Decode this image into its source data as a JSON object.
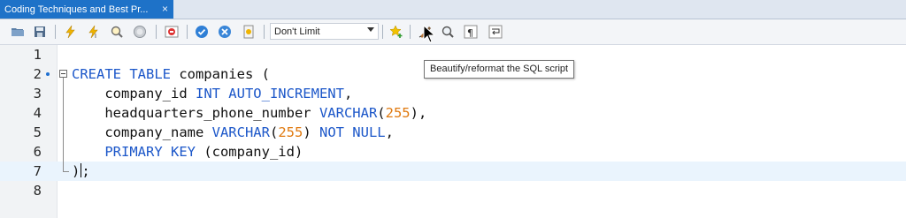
{
  "tab": {
    "title": "Coding Techniques and Best Pr...",
    "close": "×"
  },
  "toolbar": {
    "buttons": [
      {
        "name": "open-folder-icon"
      },
      {
        "name": "save-icon"
      },
      {
        "name": "execute-lightning-icon"
      },
      {
        "name": "execute-current-icon"
      },
      {
        "name": "explain-magnifier-icon"
      },
      {
        "name": "stop-icon"
      },
      {
        "name": "toggle-error-icon"
      },
      {
        "name": "commit-check-icon"
      },
      {
        "name": "rollback-cancel-icon"
      },
      {
        "name": "autocommit-icon"
      },
      {
        "name": "add-snippet-star-icon"
      },
      {
        "name": "beautify-brush-icon"
      },
      {
        "name": "find-icon"
      },
      {
        "name": "invisible-chars-icon"
      },
      {
        "name": "wrap-lines-icon"
      }
    ],
    "limit_value": "Don't Limit"
  },
  "editor": {
    "line_numbers": [
      "1",
      "2",
      "3",
      "4",
      "5",
      "6",
      "7",
      "8"
    ],
    "lines": [
      [],
      [
        {
          "t": "CREATE TABLE",
          "c": "kw"
        },
        {
          "t": " companies (",
          "c": ""
        }
      ],
      [
        {
          "t": "    company_id ",
          "c": ""
        },
        {
          "t": "INT AUTO_INCREMENT",
          "c": "kw"
        },
        {
          "t": ",",
          "c": ""
        }
      ],
      [
        {
          "t": "    headquarters_phone_number ",
          "c": ""
        },
        {
          "t": "VARCHAR",
          "c": "kw"
        },
        {
          "t": "(",
          "c": ""
        },
        {
          "t": "255",
          "c": "num"
        },
        {
          "t": "),",
          "c": ""
        }
      ],
      [
        {
          "t": "    company_name ",
          "c": ""
        },
        {
          "t": "VARCHAR",
          "c": "kw"
        },
        {
          "t": "(",
          "c": ""
        },
        {
          "t": "255",
          "c": "num"
        },
        {
          "t": ") ",
          "c": ""
        },
        {
          "t": "NOT NULL",
          "c": "kw"
        },
        {
          "t": ",",
          "c": ""
        }
      ],
      [
        {
          "t": "    ",
          "c": ""
        },
        {
          "t": "PRIMARY KEY",
          "c": "kw"
        },
        {
          "t": " (company_id)",
          "c": ""
        }
      ],
      [
        {
          "t": ")",
          "c": ""
        },
        {
          "t": "|",
          "c": "caret"
        },
        {
          "t": ";",
          "c": ""
        }
      ],
      []
    ],
    "current_line": 7
  },
  "tooltip": {
    "text": "Beautify/reformat the SQL script"
  },
  "colors": {
    "tab": "#1e72c8",
    "keyword": "#1c57c9",
    "number": "#e07a10",
    "current_line": "#eaf4fd"
  }
}
